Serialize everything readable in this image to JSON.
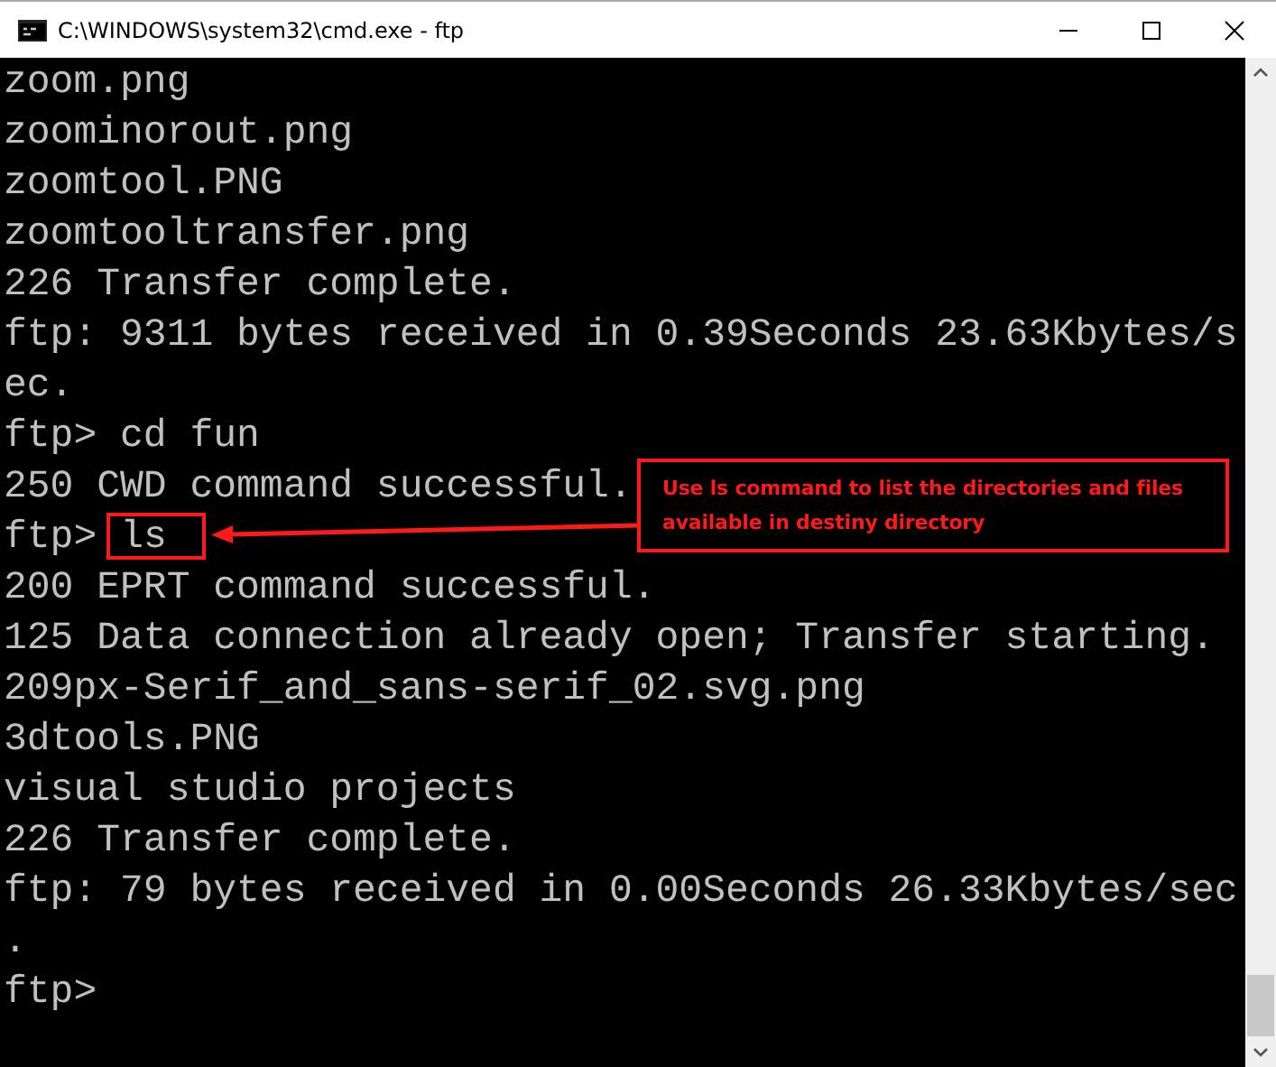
{
  "window": {
    "title": "C:\\WINDOWS\\system32\\cmd.exe - ftp"
  },
  "console": {
    "lines": [
      {
        "kind": "output",
        "text": "zoom.png"
      },
      {
        "kind": "output",
        "text": "zoominorout.png"
      },
      {
        "kind": "output",
        "text": "zoomtool.PNG"
      },
      {
        "kind": "output",
        "text": "zoomtooltransfer.png"
      },
      {
        "kind": "output",
        "text": "226 Transfer complete."
      },
      {
        "kind": "output",
        "text": "ftp: 9311 bytes received in 0.39Seconds 23.63Kbytes/s"
      },
      {
        "kind": "output",
        "text": "ec."
      },
      {
        "kind": "output",
        "text": "ftp> cd fun"
      },
      {
        "kind": "output",
        "text": "250 CWD command successful."
      },
      {
        "kind": "highlighted",
        "prompt": "ftp>",
        "command": "ls"
      },
      {
        "kind": "output",
        "text": "200 EPRT command successful."
      },
      {
        "kind": "output",
        "text": "125 Data connection already open; Transfer starting."
      },
      {
        "kind": "output",
        "text": "209px-Serif_and_sans-serif_02.svg.png"
      },
      {
        "kind": "output",
        "text": "3dtools.PNG"
      },
      {
        "kind": "output",
        "text": "visual studio projects"
      },
      {
        "kind": "output",
        "text": "226 Transfer complete."
      },
      {
        "kind": "output",
        "text": "ftp: 79 bytes received in 0.00Seconds 26.33Kbytes/sec"
      },
      {
        "kind": "output",
        "text": "."
      },
      {
        "kind": "output",
        "text": "ftp>"
      }
    ],
    "annotation": "Use ls command to list the directories and files available in destiny directory"
  }
}
